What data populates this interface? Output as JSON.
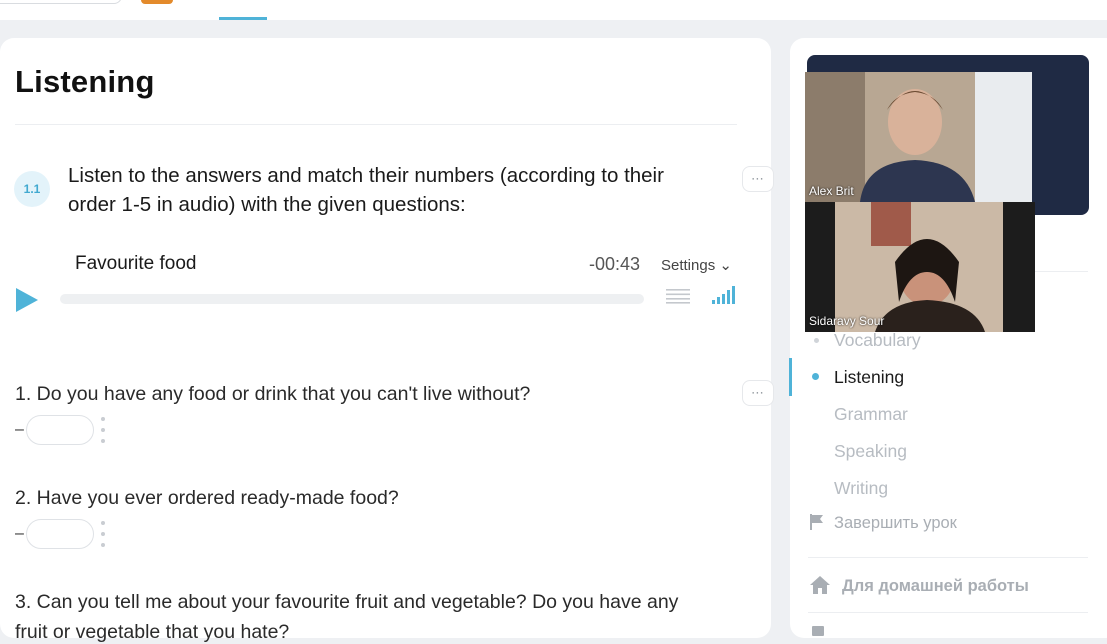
{
  "lesson": {
    "section_title": "Listening",
    "exercise": {
      "number": "1.1",
      "instruction": "Listen to the answers and match their numbers (according to their order 1-5 in audio) with the given questions:",
      "more_icon": "⋯"
    },
    "audio": {
      "title": "Favourite food",
      "time_remaining": "-00:43",
      "settings_label": "Settings",
      "settings_chevron": "⌄",
      "progress": 0,
      "play_icon": "play-icon",
      "transcript_icon": "transcript-icon",
      "volume_icon": "volume-bars-icon"
    },
    "questions": [
      {
        "text": "1. Do you have any food or drink that you can't live without?",
        "dash": "–",
        "answer": ""
      },
      {
        "text": "2. Have you ever ordered ready-made food?",
        "dash": "–",
        "answer": ""
      },
      {
        "text": "3. Can you tell me about your favourite fruit and vegetable? Do you have any",
        "continuation": "fruit or vegetable that you hate?"
      }
    ]
  },
  "video_call": {
    "participants": [
      {
        "name": "Alex Brit"
      },
      {
        "name": "Sidaravy Sour"
      }
    ]
  },
  "sidebar": {
    "nav": [
      {
        "label": "Vocabulary",
        "state": "done"
      },
      {
        "label": "Listening",
        "state": "active"
      },
      {
        "label": "Grammar",
        "state": "upcoming"
      },
      {
        "label": "Speaking",
        "state": "upcoming"
      },
      {
        "label": "Writing",
        "state": "upcoming"
      }
    ],
    "finish_lesson": "Завершить урок",
    "homework": "Для домашней работы"
  },
  "colors": {
    "accent": "#4fb3d8",
    "panel_dark": "#1f2a44",
    "muted_text": "#b7bcc2"
  }
}
